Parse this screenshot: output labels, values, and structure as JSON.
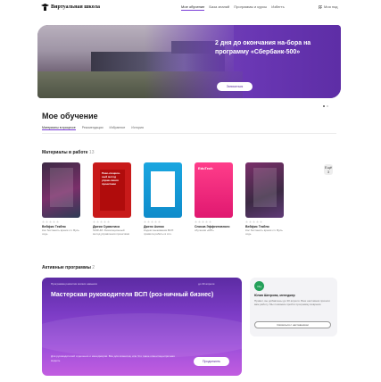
{
  "header": {
    "logo_text": "Виртуальная школа",
    "nav": [
      "Мое обучение",
      "База знаний",
      "Программы и курсы",
      "Избегть"
    ],
    "profile": "Моя под"
  },
  "banner": {
    "title": "2 дня до окончания на-бора на программу «Сбербанк-500»",
    "button": "Записаться"
  },
  "learning": {
    "title": "Мое обучение",
    "tabs": [
      "Материалы в процессе",
      "Рекомендации",
      "Избранное",
      "История"
    ]
  },
  "materials": {
    "title": "Материалы в работе",
    "count": "13",
    "next_label": "Ещё",
    "next_count": "3",
    "books": [
      {
        "title": "Вейфис Текйпо",
        "desc": "Кос бостанить время сл. Вуль ходь"
      },
      {
        "title": "Джеки Суавотиса",
        "desc": "SCRUM. Революционный метод управления проектами"
      },
      {
        "title": "Дженк Амнок",
        "desc": "Кодекс выживания ВСП: правила работы в сло."
      },
      {
        "title": "Списка Эффективного",
        "desc": "обучения «МП»"
      },
      {
        "title": "Вейфис Текйпо",
        "desc": "Кос бостанить время сл. Вуль ходь"
      }
    ],
    "cover2_text": "Рево-люцион-ный метод управ-ления проектами",
    "cover4_text": "EduTech"
  },
  "programs": {
    "title": "Активные программы",
    "count": "2",
    "card": {
      "caption": "Программа развития мягких навыков",
      "date": "до 30 апреля",
      "title": "Мастерская руководителя ВСП (роз-ничный бизнес)",
      "desc": "Для руководителей отделения и менеджеров. Все для клиентов, или Что такое клиентоцентричная модель",
      "button": "Продолжить"
    }
  },
  "mentor": {
    "avatar": "ОЦ",
    "name": "Юлия Шатрова, менеджер",
    "text": "Привет, вы добавлены до 30 апреля. Ваш наставник пришли вам работу. Мы поможем пройти программу вовремя.",
    "button": "Связаться с наставником"
  }
}
